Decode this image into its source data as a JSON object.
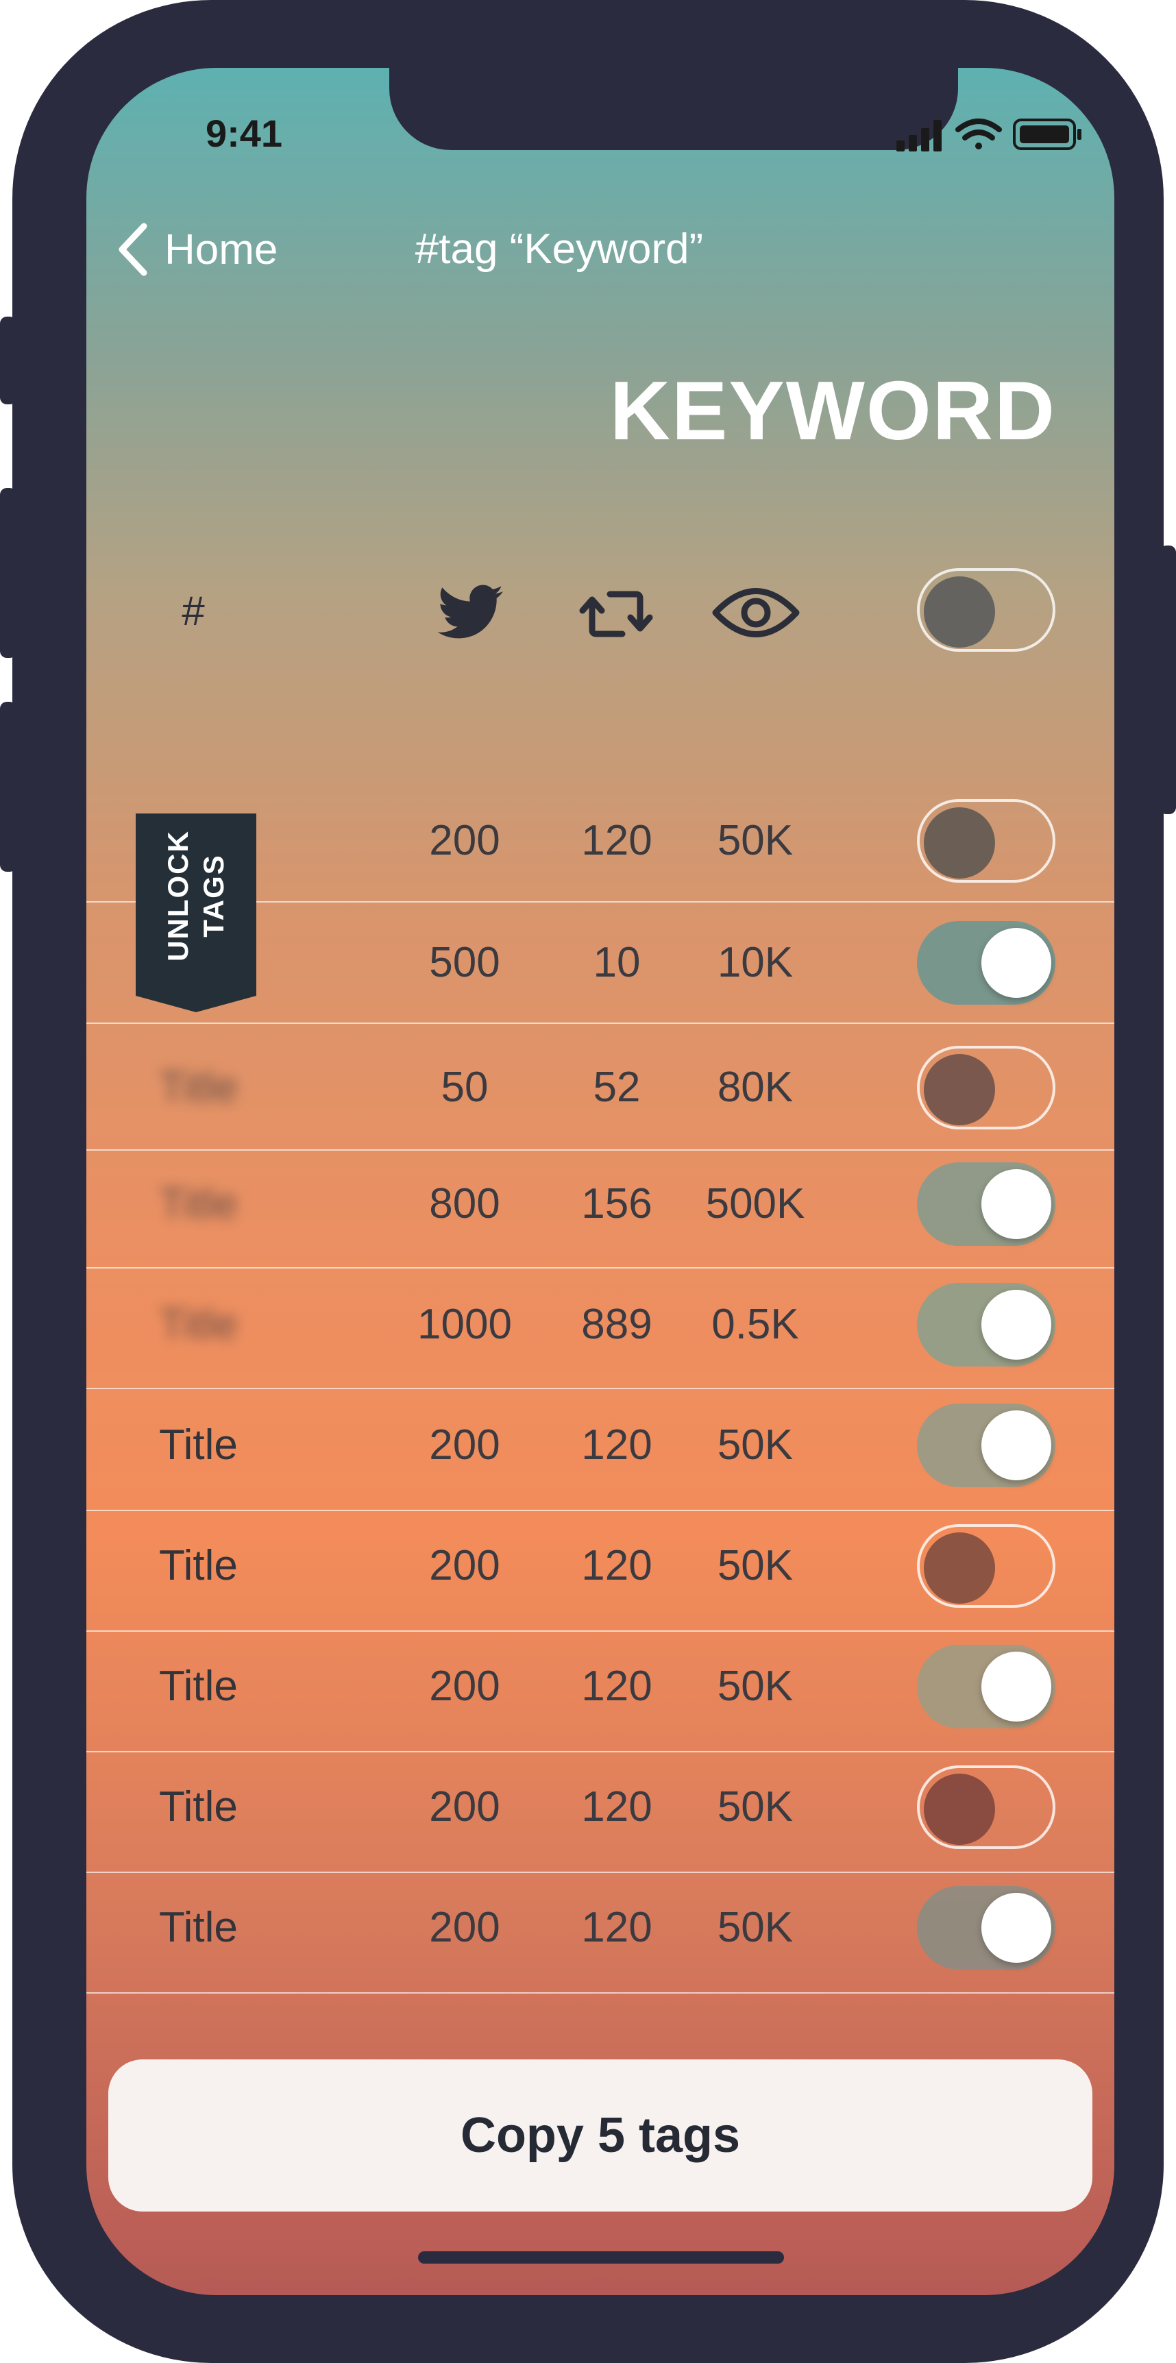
{
  "status_bar": {
    "time": "9:41",
    "icons": [
      "signal-icon",
      "wifi-icon",
      "battery-icon"
    ]
  },
  "nav": {
    "back_label": "Home",
    "title": "#tag “Keyword”"
  },
  "header": {
    "title": "KEYWORD"
  },
  "columns": {
    "tag": "#",
    "icons": [
      "twitter-bird-icon",
      "retweet-icon",
      "eye-icon"
    ],
    "select_all_on": false
  },
  "ribbon": {
    "line1": "UNLOCK",
    "line2": "TAGS"
  },
  "rows": [
    {
      "title": "",
      "blurred": false,
      "tweets": "200",
      "retweets": "120",
      "views": "50K",
      "selected": false
    },
    {
      "title": "",
      "blurred": false,
      "tweets": "500",
      "retweets": "10",
      "views": "10K",
      "selected": true
    },
    {
      "title": "Title",
      "blurred": true,
      "tweets": "50",
      "retweets": "52",
      "views": "80K",
      "selected": false
    },
    {
      "title": "Title",
      "blurred": true,
      "tweets": "800",
      "retweets": "156",
      "views": "500K",
      "selected": true
    },
    {
      "title": "Title",
      "blurred": true,
      "tweets": "1000",
      "retweets": "889",
      "views": "0.5K",
      "selected": true
    },
    {
      "title": "Title",
      "blurred": false,
      "tweets": "200",
      "retweets": "120",
      "views": "50K",
      "selected": true
    },
    {
      "title": "Title",
      "blurred": false,
      "tweets": "200",
      "retweets": "120",
      "views": "50K",
      "selected": false
    },
    {
      "title": "Title",
      "blurred": false,
      "tweets": "200",
      "retweets": "120",
      "views": "50K",
      "selected": true
    },
    {
      "title": "Title",
      "blurred": false,
      "tweets": "200",
      "retweets": "120",
      "views": "50K",
      "selected": false
    },
    {
      "title": "Title",
      "blurred": false,
      "tweets": "200",
      "retweets": "120",
      "views": "50K",
      "selected": true
    }
  ],
  "copy_button": {
    "label": "Copy 5 tags"
  },
  "colors": {
    "frame": "#2b2b40",
    "gradient_top": "#5eb1b1",
    "gradient_mid": "#f38c5a",
    "gradient_bottom": "#b65a56",
    "ribbon": "#252f38"
  }
}
